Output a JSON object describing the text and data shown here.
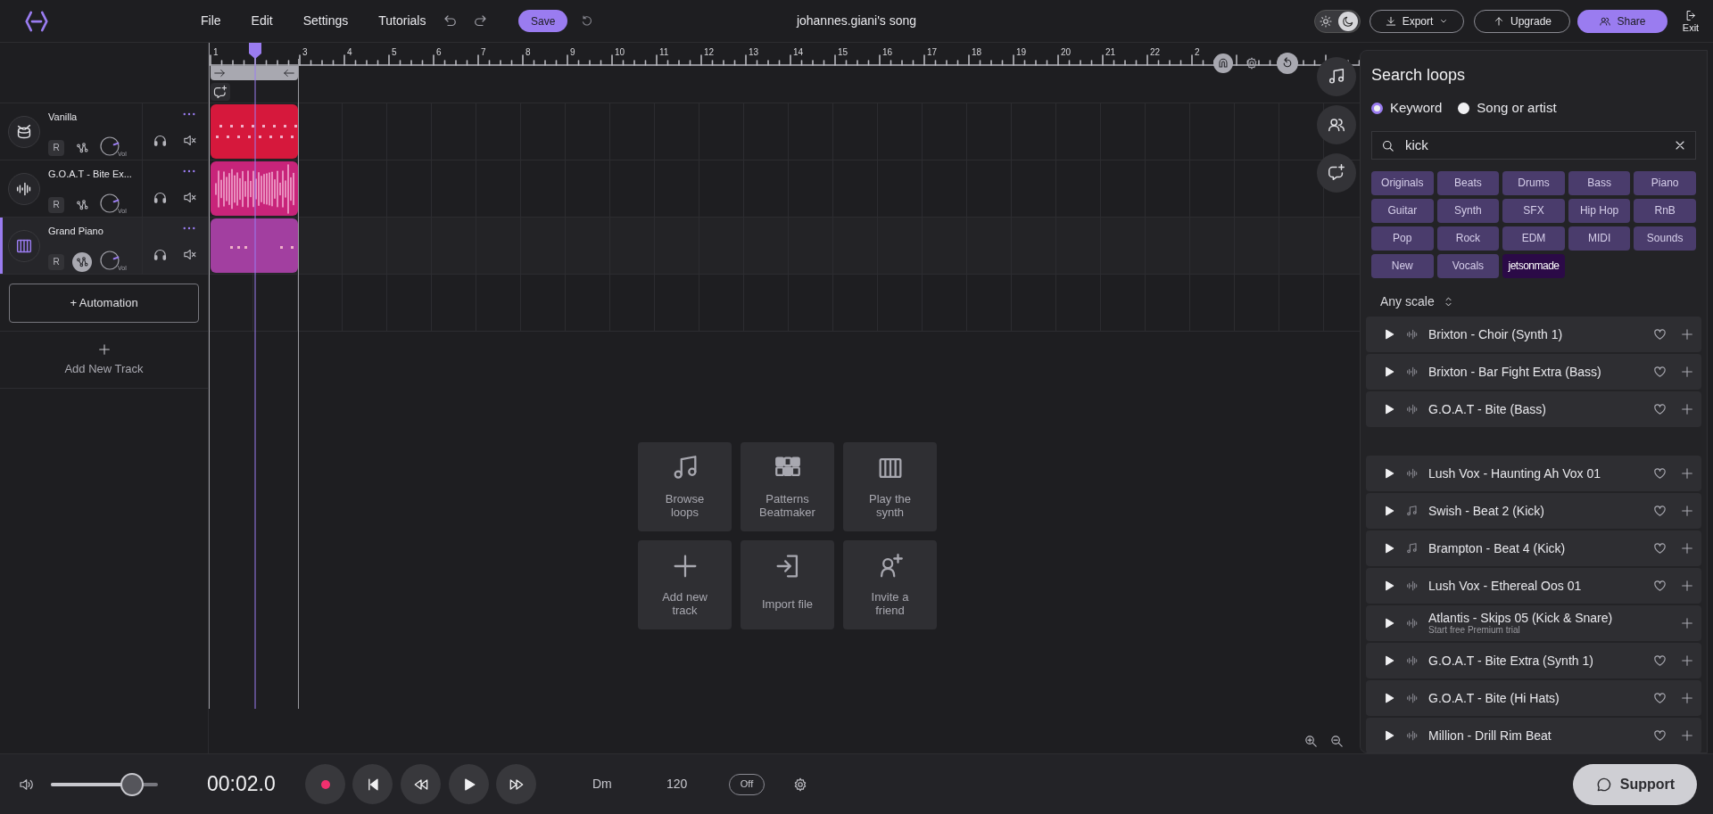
{
  "top_bar": {
    "menu": [
      "File",
      "Edit",
      "Settings",
      "Tutorials"
    ],
    "save_button": "Save",
    "song_title": "johannes.giani's song",
    "dark_mode": true,
    "export_button": "Export",
    "upgrade_button": "Upgrade",
    "share_button": "Share",
    "exit_button": "Exit"
  },
  "ruler": {
    "bar_labels": [
      "1",
      "3",
      "4",
      "5",
      "6",
      "7",
      "8",
      "9",
      "10",
      "11",
      "12",
      "13",
      "14",
      "15",
      "16",
      "17",
      "18",
      "19",
      "20",
      "21",
      "22",
      "2"
    ]
  },
  "tracks": [
    {
      "name": "Vanilla",
      "kind": "drums",
      "selected": false,
      "automation_on": false,
      "record_label": "R",
      "volume_label": "Vol",
      "color": "#d6183c"
    },
    {
      "name": "G.O.A.T - Bite Ex...",
      "kind": "audio",
      "selected": false,
      "automation_on": false,
      "record_label": "R",
      "volume_label": "Vol",
      "color": "#c8247a"
    },
    {
      "name": "Grand Piano",
      "kind": "piano",
      "selected": true,
      "automation_on": true,
      "record_label": "R",
      "volume_label": "Vol",
      "color": "#a23fa0"
    }
  ],
  "automation_button": "+ Automation",
  "add_track_button": "Add New Track",
  "quick_actions": [
    {
      "label": "Browse loops",
      "kind": "loops"
    },
    {
      "label": "Patterns Beatmaker",
      "kind": "patterns"
    },
    {
      "label": "Play the synth",
      "kind": "synth"
    },
    {
      "label": "Add new track",
      "kind": "add"
    },
    {
      "label": "Import file",
      "kind": "import"
    },
    {
      "label": "Invite a friend",
      "kind": "invite"
    }
  ],
  "loops_panel": {
    "title": "Search loops",
    "search_modes": [
      {
        "label": "Keyword",
        "selected": true
      },
      {
        "label": "Song or artist",
        "selected": false
      }
    ],
    "search": {
      "value": "kick"
    },
    "tags": [
      {
        "label": "Originals",
        "selected": false
      },
      {
        "label": "Beats",
        "selected": false
      },
      {
        "label": "Drums",
        "selected": false
      },
      {
        "label": "Bass",
        "selected": false
      },
      {
        "label": "Piano",
        "selected": false
      },
      {
        "label": "Guitar",
        "selected": false
      },
      {
        "label": "Synth",
        "selected": false
      },
      {
        "label": "SFX",
        "selected": false
      },
      {
        "label": "Hip Hop",
        "selected": false
      },
      {
        "label": "RnB",
        "selected": false
      },
      {
        "label": "Pop",
        "selected": false
      },
      {
        "label": "Rock",
        "selected": false
      },
      {
        "label": "EDM",
        "selected": false
      },
      {
        "label": "MIDI",
        "selected": false
      },
      {
        "label": "Sounds",
        "selected": false
      },
      {
        "label": "New",
        "selected": false
      },
      {
        "label": "Vocals",
        "selected": false
      },
      {
        "label": "jetsonmade",
        "selected": true
      }
    ],
    "scale_filter": "Any scale",
    "groups": [
      {
        "results": [
          {
            "title": "Brixton - Choir (Synth 1)",
            "kind": "audio",
            "premium": false
          },
          {
            "title": "Brixton - Bar Fight Extra (Bass)",
            "kind": "audio",
            "premium": false
          },
          {
            "title": "G.O.A.T - Bite (Bass)",
            "kind": "audio",
            "premium": false
          }
        ]
      },
      {
        "results": [
          {
            "title": "Lush Vox - Haunting Ah Vox 01",
            "kind": "audio",
            "premium": false
          },
          {
            "title": "Swish - Beat 2 (Kick)",
            "kind": "midi",
            "premium": false
          },
          {
            "title": "Brampton - Beat 4 (Kick)",
            "kind": "midi",
            "premium": false
          },
          {
            "title": "Lush Vox - Ethereal Oos 01",
            "kind": "audio",
            "premium": false
          },
          {
            "title": "Atlantis - Skips 05 (Kick & Snare)",
            "kind": "audio",
            "premium": true,
            "subtitle": "Start free Premium trial"
          },
          {
            "title": "G.O.A.T - Bite Extra (Synth 1)",
            "kind": "audio",
            "premium": false
          },
          {
            "title": "G.O.A.T - Bite (Hi Hats)",
            "kind": "audio",
            "premium": false
          },
          {
            "title": "Million - Drill Rim Beat",
            "kind": "audio",
            "premium": false
          }
        ]
      }
    ]
  },
  "transport": {
    "level": 0.76,
    "time": "00:02.0",
    "key": "Dm",
    "tempo": "120",
    "metronome": "Off",
    "support_button": "Support"
  }
}
